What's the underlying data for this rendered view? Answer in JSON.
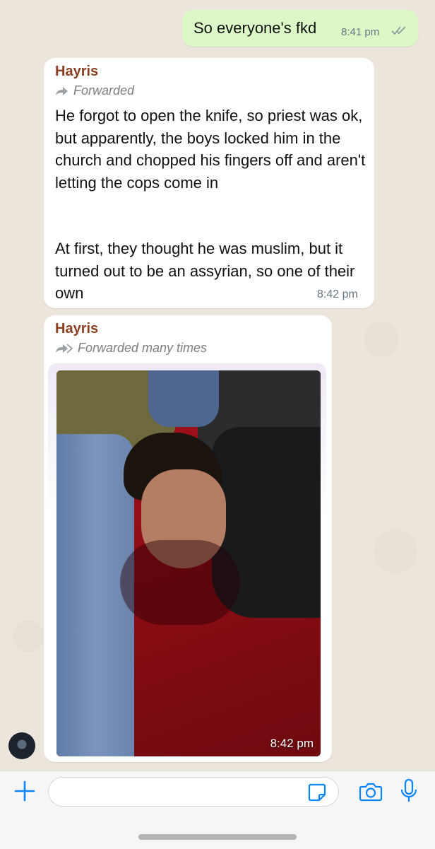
{
  "colors": {
    "accent": "#0a84ff",
    "outgoing_bubble": "#dcf8c6",
    "incoming_bubble": "#ffffff",
    "sender_name": "#8b3f21",
    "timestamp": "#667781",
    "chat_background": "#ece5dc"
  },
  "messages": {
    "outgoing": {
      "text": "So everyone's fkd",
      "time": "8:41 pm",
      "status_icon": "double-check-icon"
    },
    "incoming_1": {
      "sender": "Hayris",
      "forwarded_label": "Forwarded",
      "paragraph_1": "He forgot to open the knife, so priest was ok, but apparently, the boys locked him in the church and chopped his fingers off and aren't letting the cops come in",
      "paragraph_2": "At first, they thought he was muslim, but it turned out to be an assyrian, so one of their own",
      "time": "8:42 pm"
    },
    "incoming_2": {
      "sender": "Hayris",
      "forwarded_label": "Forwarded many times",
      "media": "photo",
      "time": "8:42 pm"
    }
  },
  "input_bar": {
    "icons": [
      "plus-icon",
      "sticker-icon",
      "camera-icon",
      "microphone-icon"
    ]
  }
}
